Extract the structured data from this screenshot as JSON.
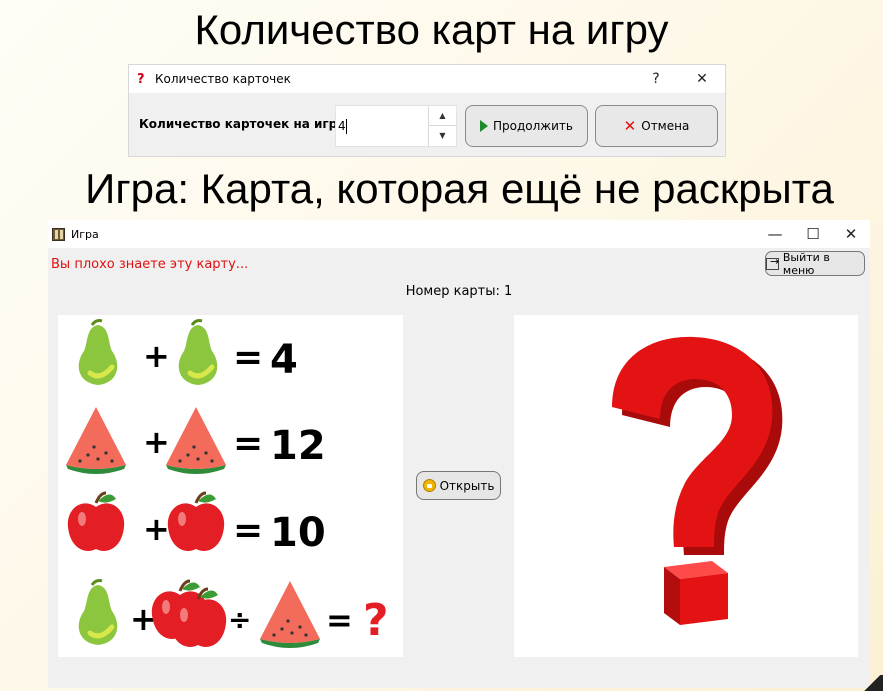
{
  "slide": {
    "title_top": "Количество карт на игру",
    "title_game": "Игра: Карта, которая ещё не раскрыта"
  },
  "count_dialog": {
    "title": "Количество карточек",
    "help_glyph": "?",
    "close_glyph": "✕",
    "label": "Количество карточек на игру:",
    "value": "4",
    "continue_label": "Продолжить",
    "cancel_label": "Отмена"
  },
  "game_window": {
    "title": "Игра",
    "minimize_glyph": "—",
    "maximize_glyph": "☐",
    "close_glyph": "✕",
    "warning": "Вы плохо знаете эту карту...",
    "exit_label": "Выйти в меню",
    "card_number": "Номер карты: 1",
    "open_label": "Открыть",
    "puzzle": {
      "rows": [
        {
          "items": [
            "pear",
            "plus",
            "pear",
            "equals"
          ],
          "result": "4"
        },
        {
          "items": [
            "watermelon",
            "plus",
            "watermelon",
            "equals"
          ],
          "result": "12"
        },
        {
          "items": [
            "apple",
            "plus",
            "apple",
            "equals"
          ],
          "result": "10"
        },
        {
          "items": [
            "pear",
            "plus",
            "apples-pair",
            "divide",
            "watermelon",
            "equals"
          ],
          "result": "?"
        }
      ]
    }
  },
  "colors": {
    "warning": "#e01010",
    "question_mark": "#e41313",
    "continue_icon": "#1e8a2e",
    "cancel_icon": "#e01010"
  }
}
